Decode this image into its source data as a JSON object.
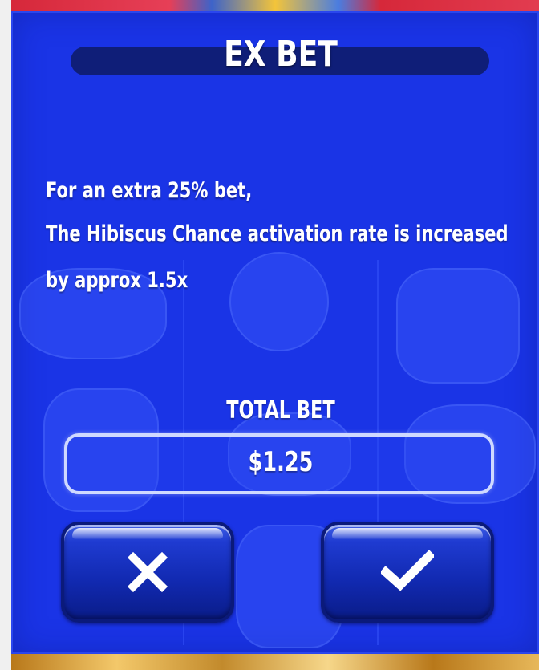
{
  "dialog": {
    "title": "EX BET",
    "description": [
      "For an extra 25% bet,",
      "The Hibiscus Chance activation rate is increased",
      "by approx 1.5x"
    ],
    "total_bet_label": "TOTAL BET",
    "total_bet_value": "$1.25"
  },
  "buttons": {
    "cancel_icon": "close-x-icon",
    "confirm_icon": "checkmark-icon"
  },
  "colors": {
    "panel": "#1a34e6",
    "title_bar": "#0f1e78",
    "text": "#ffffff"
  }
}
